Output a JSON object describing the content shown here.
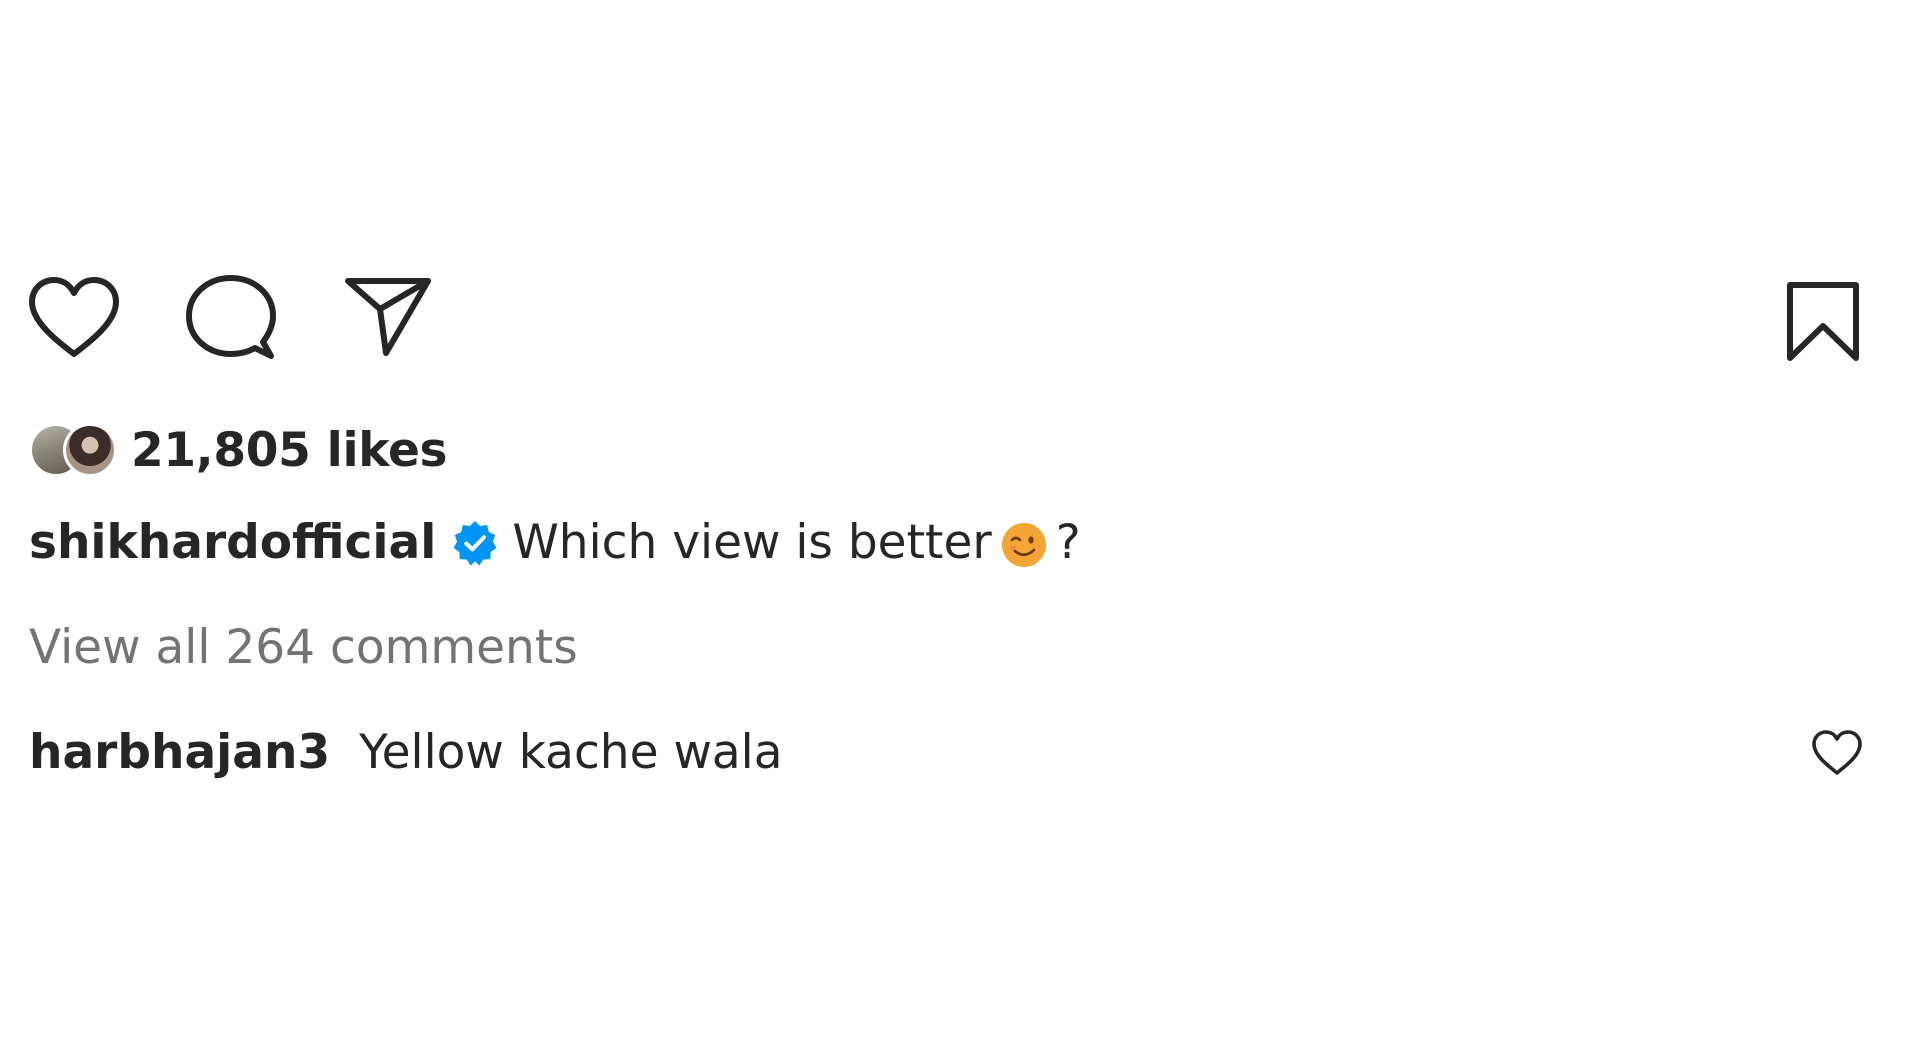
{
  "actions": {
    "like_icon": "heart-outline-icon",
    "comment_icon": "speech-bubble-icon",
    "share_icon": "paper-plane-icon",
    "save_icon": "bookmark-icon"
  },
  "likes": {
    "count_label": "21,805 likes"
  },
  "caption": {
    "username": "shikhardofficial",
    "verified": true,
    "text": "Which view is better",
    "emoji": "winking-face",
    "end": "?"
  },
  "comments": {
    "view_all_label": "View all 264 comments",
    "items": [
      {
        "username": "harbhajan3",
        "text": "Yellow kache wala"
      }
    ]
  },
  "colors": {
    "text_primary": "#262626",
    "text_secondary": "#737373",
    "verified_blue": "#0095f6",
    "background": "#ffffff"
  }
}
